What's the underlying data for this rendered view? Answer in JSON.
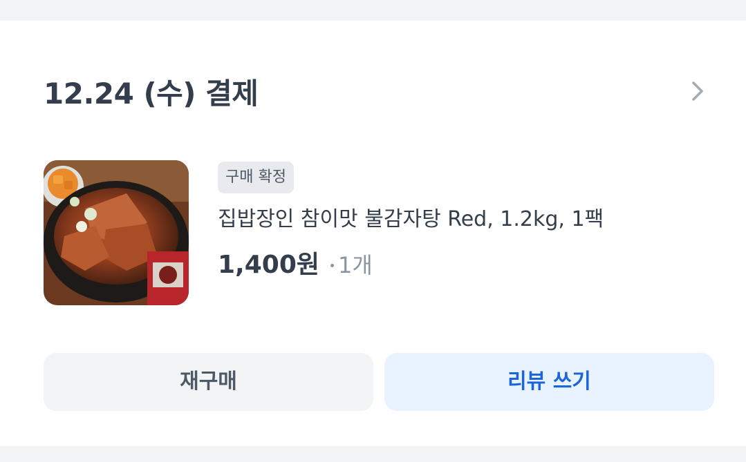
{
  "order": {
    "date_label": "12.24 (수) 결제",
    "chevron_icon": "chevron-right-icon"
  },
  "item": {
    "status_badge": "구매 확정",
    "name": "집밥장인 참이맛 불감자탕 Red, 1.2kg, 1팩",
    "price": "1,400원",
    "quantity": "1개",
    "thumbnail_icon": "product-image"
  },
  "actions": {
    "rebuy_label": "재구매",
    "review_label": "리뷰 쓰기"
  },
  "colors": {
    "text_primary": "#333d4b",
    "text_secondary": "#8b95a1",
    "badge_bg": "#e8eaed",
    "rebuy_bg": "#f2f4f6",
    "review_bg": "#e8f3ff",
    "review_text": "#1b64da",
    "page_bg": "#f2f3f5"
  }
}
